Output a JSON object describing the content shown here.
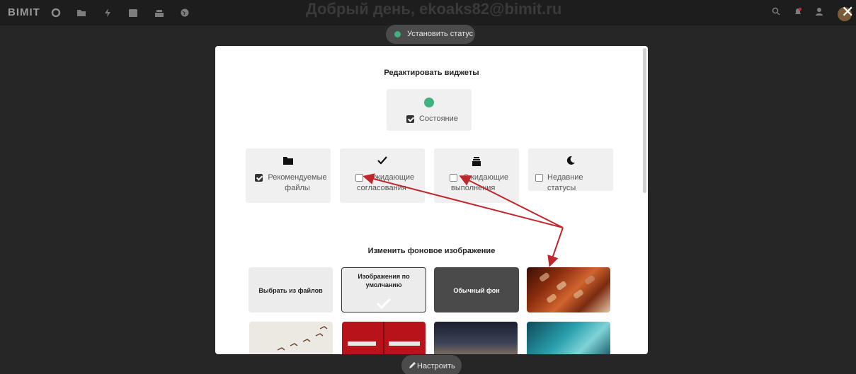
{
  "topbar": {
    "logo": "BIMIT",
    "greeting": "Добрый день, ekoaks82@bimit.ru",
    "icons": [
      "circle-icon",
      "folder-icon",
      "bolt-icon",
      "calendar-icon",
      "archive-icon",
      "globe-icon"
    ],
    "right_icons": [
      "search-icon",
      "bell-icon",
      "user-add-icon"
    ]
  },
  "status_button": {
    "label": "Установить статус"
  },
  "config_button": {
    "label": "Настроить"
  },
  "modal": {
    "title": "Редактировать виджеты",
    "status_widget": {
      "label": "Состояние",
      "checked": true
    },
    "widgets": [
      {
        "icon": "folder-icon",
        "line1": "Рекомендуемые",
        "line2": "файлы",
        "checked": true
      },
      {
        "icon": "check-icon",
        "line1": "Ожидающие",
        "line2": "согласования",
        "checked": false
      },
      {
        "icon": "inbox-icon",
        "line1": "Ожидающие",
        "line2": "выполнения",
        "checked": false
      },
      {
        "icon": "moon-icon",
        "line1": "Недавние статусы",
        "line2": "",
        "checked": false
      }
    ],
    "background_title": "Изменить фоновое изображение",
    "background_options": {
      "from_files": "Выбрать из файлов",
      "default_images": "Изображения по умолчанию",
      "plain": "Обычный фон"
    }
  },
  "colors": {
    "status_dot": "#3fb27f",
    "annotation_arrow": "#c0272d"
  }
}
